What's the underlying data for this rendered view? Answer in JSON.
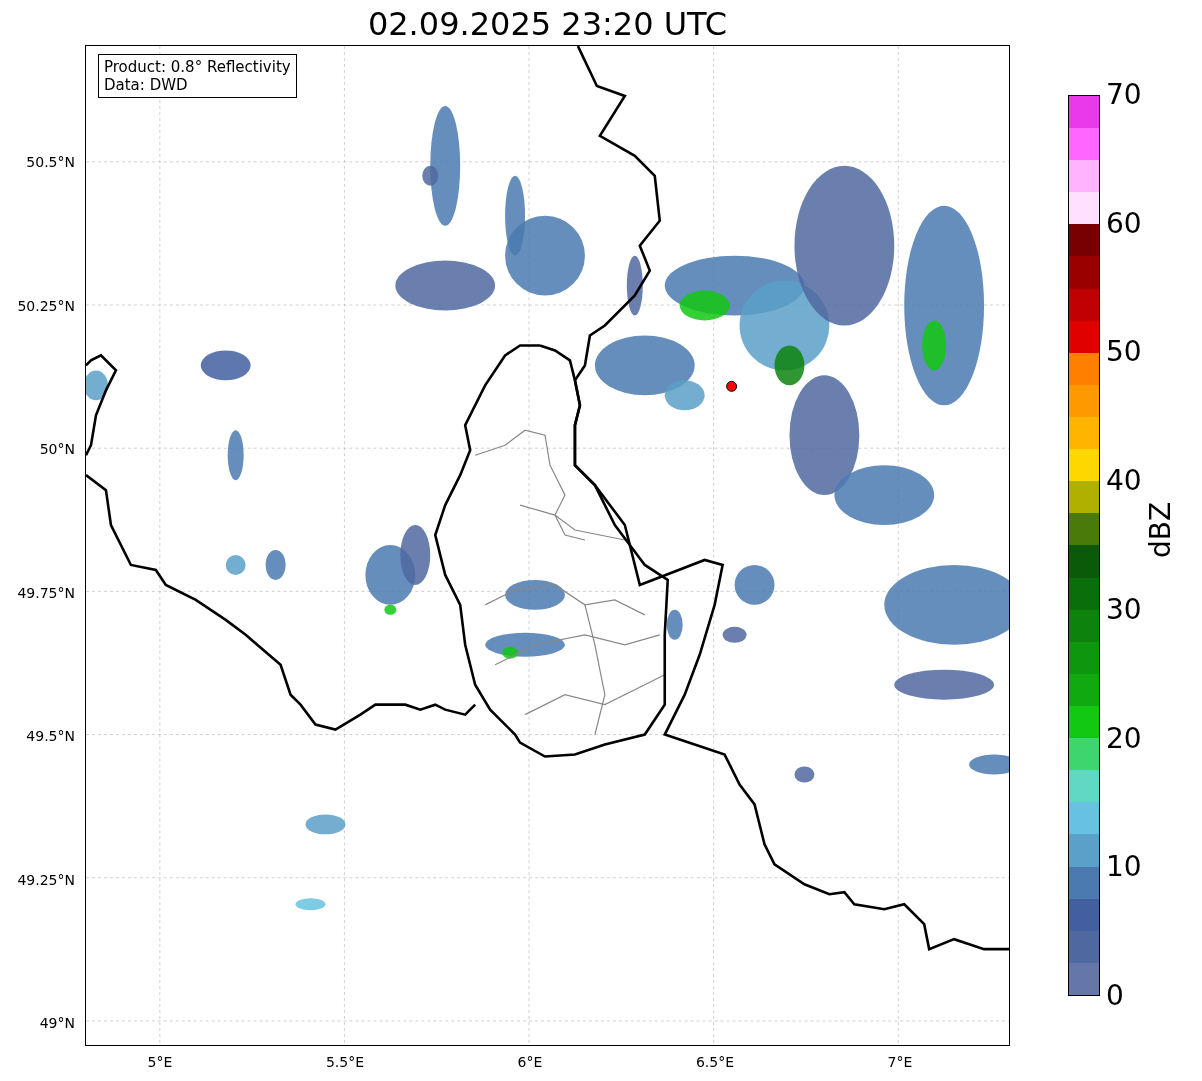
{
  "title": "02.09.2025 23:20 UTC",
  "legend": [
    "Product: 0.8° Reflectivity",
    "Data: DWD"
  ],
  "x_ticks": [
    "5°E",
    "5.5°E",
    "6°E",
    "6.5°E",
    "7°E"
  ],
  "y_ticks": [
    "50.5°N",
    "50.25°N",
    "50°N",
    "49.75°N",
    "49.5°N",
    "49.25°N",
    "49°N"
  ],
  "colorbar": {
    "label": "dBZ",
    "ticks": [
      "70",
      "60",
      "50",
      "40",
      "30",
      "20",
      "10",
      "0"
    ],
    "bands": [
      {
        "color": "#6477a8"
      },
      {
        "color": "#5068a0"
      },
      {
        "color": "#4260a0"
      },
      {
        "color": "#4a7ab0"
      },
      {
        "color": "#5aa0c8"
      },
      {
        "color": "#66c2e0"
      },
      {
        "color": "#5fd8c4"
      },
      {
        "color": "#3dd66e"
      },
      {
        "color": "#12c812"
      },
      {
        "color": "#10aa10"
      },
      {
        "color": "#0f960f"
      },
      {
        "color": "#0d820d"
      },
      {
        "color": "#0a6e0a"
      },
      {
        "color": "#0a5a0a"
      },
      {
        "color": "#4a7a0a"
      },
      {
        "color": "#b0b000"
      },
      {
        "color": "#ffd700"
      },
      {
        "color": "#ffb400"
      },
      {
        "color": "#ff9900"
      },
      {
        "color": "#ff7f00"
      },
      {
        "color": "#e00000"
      },
      {
        "color": "#c00000"
      },
      {
        "color": "#9a0000"
      },
      {
        "color": "#780000"
      },
      {
        "color": "#ffe0ff"
      },
      {
        "color": "#ffb3ff"
      },
      {
        "color": "#ff66ff"
      },
      {
        "color": "#e93ae9"
      }
    ]
  }
}
